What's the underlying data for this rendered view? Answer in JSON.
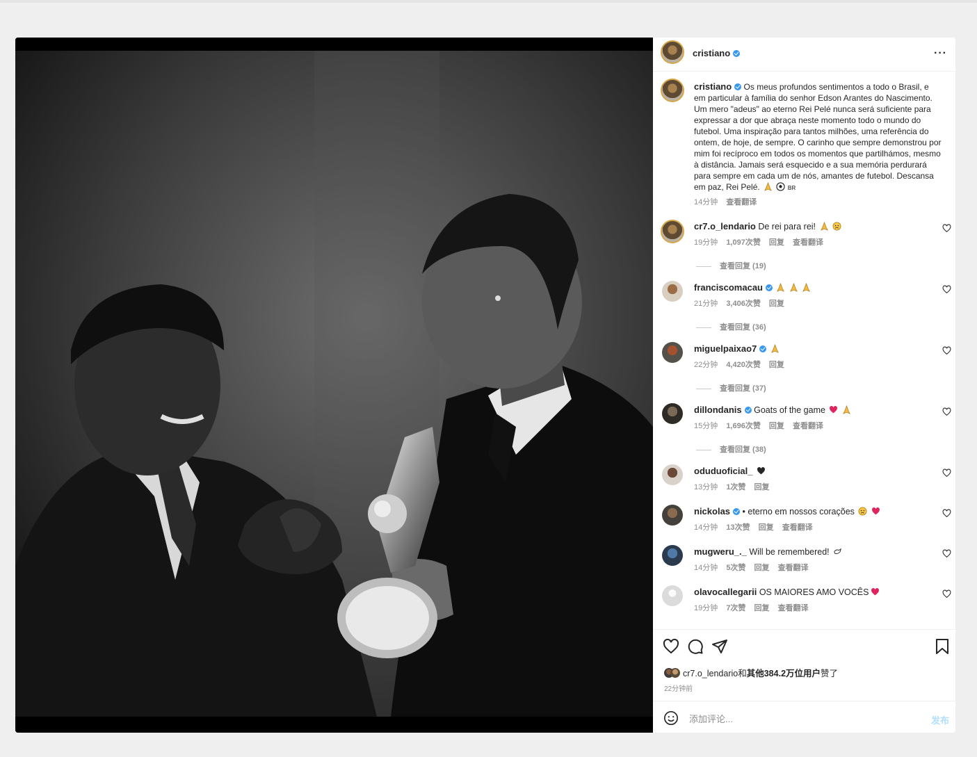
{
  "post": {
    "author": "cristiano",
    "caption": "Os meus profundos sentimentos a todo o Brasil, e em particular à família do senhor Edson Arantes do Nascimento. Um mero \"adeus\" ao eterno Rei Pelé nunca será suficiente para expressar a dor que abraça neste momento todo o mundo do futebol. Uma inspiração para tantos milhões, uma referência do ontem, de hoje, de sempre. O carinho que sempre demonstrou por mim foi recíproco em todos os momentos que partilhámos, mesmo à distância. Jamais será esquecido e a sua memória perdurará para sempre em cada um de nós, amantes de futebol. Descansa em paz, Rei Pelé.",
    "caption_flag": "BR",
    "caption_time": "14分钟",
    "see_translation": "查看翻译"
  },
  "comments": [
    {
      "user": "cr7.o_lendario",
      "verified": false,
      "text": "De rei para rei!",
      "time": "19分钟",
      "likes": "1,097次赞",
      "reply": "回复",
      "translate": "查看翻译",
      "replies": "查看回复 (19)"
    },
    {
      "user": "franciscomacau",
      "verified": true,
      "text": "",
      "time": "21分钟",
      "likes": "3,406次赞",
      "reply": "回复",
      "translate": "",
      "replies": "查看回复 (36)"
    },
    {
      "user": "miguelpaixao7",
      "verified": true,
      "text": "",
      "time": "22分钟",
      "likes": "4,420次赞",
      "reply": "回复",
      "translate": "",
      "replies": "查看回复 (37)"
    },
    {
      "user": "dillondanis",
      "verified": true,
      "text": "Goats of the game",
      "time": "15分钟",
      "likes": "1,696次赞",
      "reply": "回复",
      "translate": "查看翻译",
      "replies": "查看回复 (38)"
    },
    {
      "user": "oduduoficial_",
      "verified": false,
      "text": "",
      "time": "13分钟",
      "likes": "1次赞",
      "reply": "回复",
      "translate": "",
      "replies": ""
    },
    {
      "user": "nickolas",
      "verified": true,
      "text": "• eterno em nossos corações",
      "time": "14分钟",
      "likes": "13次赞",
      "reply": "回复",
      "translate": "查看翻译",
      "replies": ""
    },
    {
      "user": "mugweru_._",
      "verified": false,
      "text": "Will be remembered!",
      "time": "14分钟",
      "likes": "5次赞",
      "reply": "回复",
      "translate": "查看翻译",
      "replies": ""
    },
    {
      "user": "olavocallegarii",
      "verified": false,
      "text": "OS MAIORES AMO VOCÊS",
      "time": "19分钟",
      "likes": "7次赞",
      "reply": "回复",
      "translate": "查看翻译",
      "replies": ""
    }
  ],
  "likes": {
    "user": "cr7.o_lendario",
    "mid": "和",
    "others": "其他384.2万位用户",
    "suffix": "赞了",
    "time_ago": "22分钟前"
  },
  "add_comment": {
    "placeholder": "添加评论...",
    "post_label": "发布"
  },
  "colors": {
    "verified": "#3897f0",
    "link_disabled": "#b2dffc",
    "heart": "#e0245e"
  }
}
